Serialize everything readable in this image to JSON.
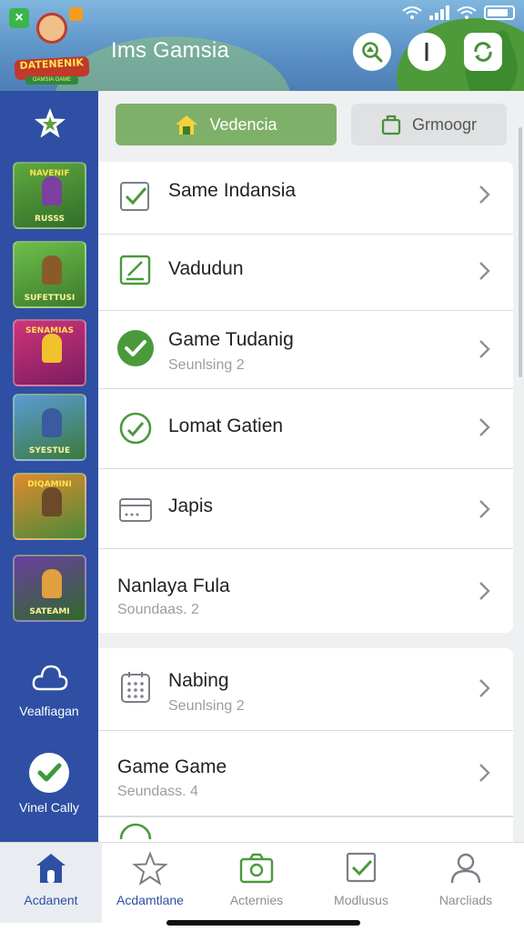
{
  "header": {
    "title": "Ims Gamsia",
    "logo_text": "DATENENIK",
    "logo_subtext": "GAMSIA GAME",
    "buttons": [
      "search-icon",
      "info-icon",
      "refresh-icon"
    ]
  },
  "sidebar": {
    "thumbnails": [
      {
        "label": "RUSSS",
        "title": "NAVENIF",
        "bg1": "#5fa83e",
        "bg2": "#2f6f2a"
      },
      {
        "label": "SUFETTUSI",
        "title": "",
        "bg1": "#6cbf4a",
        "bg2": "#3d7a2b"
      },
      {
        "label": "",
        "title": "SENAMIAS",
        "bg1": "#d0337a",
        "bg2": "#7a1d5f"
      },
      {
        "label": "SYESTUE",
        "title": "",
        "bg1": "#5b9bd5",
        "bg2": "#3a7a3a"
      },
      {
        "label": "",
        "title": "DIQAMINI",
        "bg1": "#e08a2c",
        "bg2": "#4a8a3a"
      },
      {
        "label": "SATEAMI",
        "title": "",
        "bg1": "#6b3fa0",
        "bg2": "#2f6a2a"
      }
    ],
    "items": [
      {
        "label": "Vealfiagan",
        "icon": "cloud-icon"
      },
      {
        "label": "Vinel Cally",
        "icon": "check-circle-icon"
      }
    ]
  },
  "tabs": [
    {
      "label": "Vedencia",
      "icon": "home-icon"
    },
    {
      "label": "Grmoogr",
      "icon": "bag-icon"
    }
  ],
  "list1": [
    {
      "title": "Same Indansia",
      "subtitle": "",
      "icon": "checkbox-icon"
    },
    {
      "title": "Vadudun",
      "subtitle": "",
      "icon": "edit-icon"
    },
    {
      "title": "Game Tudanig",
      "subtitle": "Seunlsing 2",
      "icon": "check-filled-icon"
    },
    {
      "title": "Lomat Gatien",
      "subtitle": "",
      "icon": "check-outline-icon"
    },
    {
      "title": "Japis",
      "subtitle": "",
      "icon": "card-icon"
    },
    {
      "title": "Nanlaya Fula",
      "subtitle": "Soundaas. 2",
      "icon": ""
    }
  ],
  "list2": [
    {
      "title": "Nabing",
      "subtitle": "Seunlsing 2",
      "icon": "calendar-icon"
    },
    {
      "title": "Game Game",
      "subtitle": "Seundass. 4",
      "icon": ""
    }
  ],
  "bottom_nav": [
    {
      "label": "Acdanent",
      "icon": "home-icon"
    },
    {
      "label": "Acdamtlane",
      "icon": "star-icon"
    },
    {
      "label": "Acternies",
      "icon": "camera-icon"
    },
    {
      "label": "Modlusus",
      "icon": "checkbox-icon"
    },
    {
      "label": "Narcliads",
      "icon": "user-icon"
    }
  ],
  "colors": {
    "accent_green": "#6aa84f",
    "sidebar_blue": "#2e4fa3",
    "tab_green": "#7fb069"
  }
}
